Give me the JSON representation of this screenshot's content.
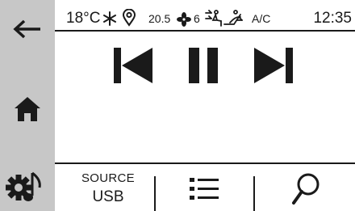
{
  "status_bar": {
    "outside_temp": "18°C",
    "setpoint": "20.5",
    "fan_speed": "6",
    "ac_label": "A/C",
    "clock": "12:35"
  },
  "sidebar": {
    "back_icon": "back-arrow-icon",
    "home_icon": "home-icon",
    "settings_icon": "settings-music-icon"
  },
  "media_controls": {
    "prev_icon": "skip-previous-icon",
    "pause_icon": "pause-icon",
    "next_icon": "skip-next-icon"
  },
  "bottom_bar": {
    "source_label": "SOURCE",
    "source_value": "USB",
    "list_icon": "list-icon",
    "search_icon": "search-icon"
  },
  "colors": {
    "sidebar_bg": "#c7c7c7",
    "foreground": "#1a1a1a",
    "background": "#ffffff"
  }
}
